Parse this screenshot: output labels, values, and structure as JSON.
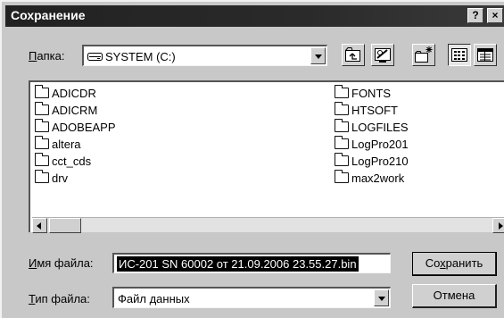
{
  "window": {
    "title": "Сохранение",
    "help_button": "?",
    "close_button": "×"
  },
  "folder_bar": {
    "label_accel": "П",
    "label_rest": "апка:",
    "current": "SYSTEM (C:)"
  },
  "toolbar": {
    "buttons": [
      "up-folder",
      "desktop",
      "new-folder",
      "list-view",
      "details-view"
    ]
  },
  "files": {
    "column1": [
      "ADICDR",
      "ADICRM",
      "ADOBEAPP",
      "altera",
      "cct_cds",
      "drv"
    ],
    "column2": [
      "FONTS",
      "HTSOFT",
      "LOGFILES",
      "LogPro201",
      "LogPro210",
      "max2work"
    ]
  },
  "filename": {
    "label_accel": "И",
    "label_rest": "мя файла:",
    "value": "ИС-201 SN 60002 от 21.09.2006 23.55.27.bin"
  },
  "filetype": {
    "label_accel": "Т",
    "label_rest": "ип файла:",
    "value": "Файл данных"
  },
  "buttons": {
    "save_pre": "Со",
    "save_accel": "х",
    "save_post": "ранить",
    "cancel": "Отмена"
  }
}
